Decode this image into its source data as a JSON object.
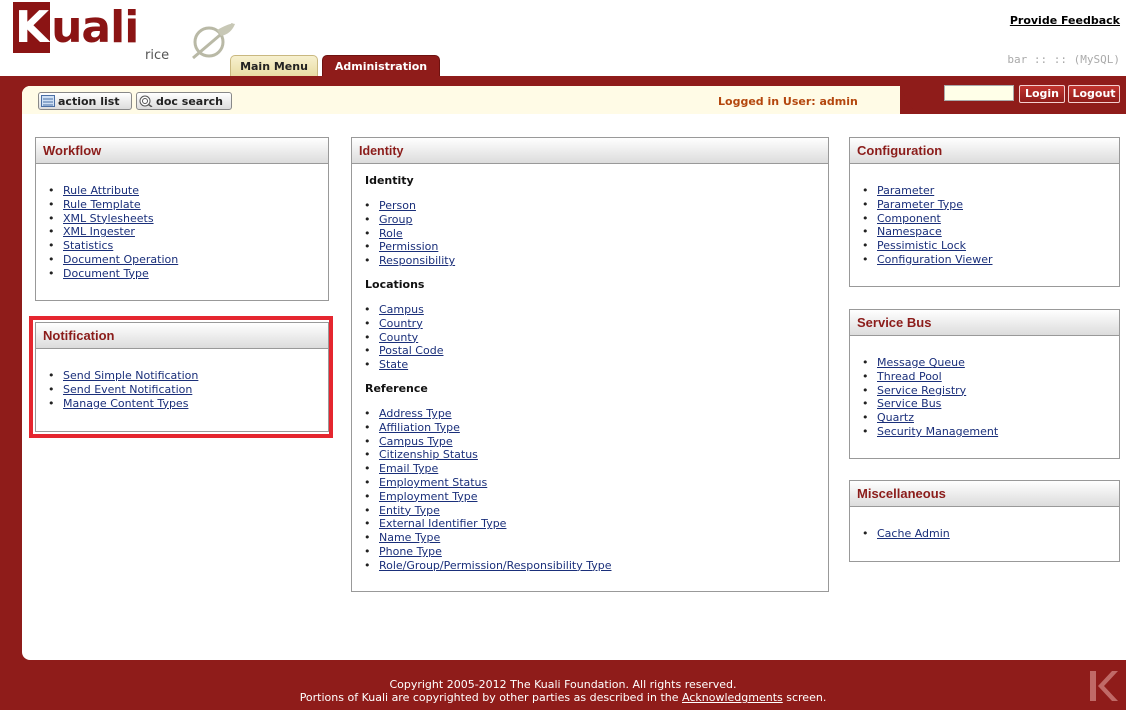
{
  "header": {
    "logo_text": "uali",
    "logo_k": "K",
    "logo_sub": "rice",
    "feedback": "Provide Feedback",
    "env_info": "bar :: :: (MySQL)",
    "tabs": [
      {
        "label": "Main Menu"
      },
      {
        "label": "Administration"
      }
    ]
  },
  "toolbar": {
    "action_list": "action list",
    "doc_search": "doc search",
    "logged_in": "Logged in User: admin",
    "login": "Login",
    "logout": "Logout"
  },
  "workflow": {
    "title": "Workflow",
    "items": [
      "Rule Attribute",
      "Rule Template",
      "XML Stylesheets",
      "XML Ingester",
      "Statistics",
      "Document Operation",
      "Document Type"
    ]
  },
  "notification": {
    "title": "Notification",
    "items": [
      "Send Simple Notification",
      "Send Event Notification",
      "Manage Content Types"
    ]
  },
  "identity": {
    "title": "Identity",
    "sections": [
      {
        "title": "Identity",
        "items": [
          "Person",
          "Group",
          "Role",
          "Permission",
          "Responsibility"
        ]
      },
      {
        "title": "Locations",
        "items": [
          "Campus",
          "Country",
          "County",
          "Postal Code",
          "State"
        ]
      },
      {
        "title": "Reference",
        "items": [
          "Address Type",
          "Affiliation Type",
          "Campus Type",
          "Citizenship Status",
          "Email Type",
          "Employment Status",
          "Employment Type",
          "Entity Type",
          "External Identifier Type",
          "Name Type",
          "Phone Type",
          "Role/Group/Permission/Responsibility Type"
        ]
      }
    ]
  },
  "configuration": {
    "title": "Configuration",
    "items": [
      "Parameter",
      "Parameter Type",
      "Component",
      "Namespace",
      "Pessimistic Lock",
      "Configuration Viewer"
    ]
  },
  "service_bus": {
    "title": "Service Bus",
    "items": [
      "Message Queue",
      "Thread Pool",
      "Service Registry",
      "Service Bus",
      "Quartz",
      "Security Management"
    ]
  },
  "miscellaneous": {
    "title": "Miscellaneous",
    "items": [
      "Cache Admin"
    ]
  },
  "footer": {
    "line1": "Copyright 2005-2012 The Kuali Foundation. All rights reserved.",
    "line2_prefix": "Portions of Kuali are copyrighted by other parties as described in the ",
    "line2_link": "Acknowledgments",
    "line2_suffix": " screen."
  },
  "colors": {
    "brand_red": "#8f1c1a",
    "link": "#1a2f7a",
    "highlight": "#e5262f",
    "user_text": "#b4470e"
  }
}
